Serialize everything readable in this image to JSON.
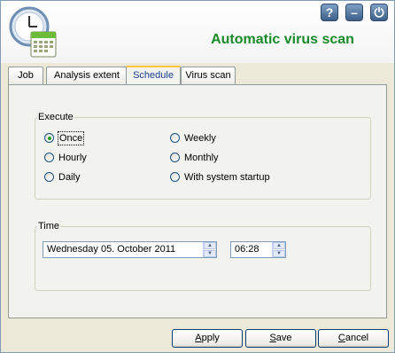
{
  "window": {
    "title": "Automatic virus scan"
  },
  "icons": {
    "app": "calendar-clock-icon",
    "help": "help-icon",
    "minimize": "minimize-icon",
    "close": "power-icon"
  },
  "window_buttons": {
    "help": "?",
    "minimize": "–",
    "close": "⏻"
  },
  "tabs": [
    {
      "label": "Job",
      "active": false
    },
    {
      "label": "Analysis extent",
      "active": false
    },
    {
      "label": "Schedule",
      "active": true
    },
    {
      "label": "Virus scan",
      "active": false
    }
  ],
  "execute": {
    "legend": "Execute",
    "options": [
      {
        "label": "Once",
        "checked": true
      },
      {
        "label": "Hourly",
        "checked": false
      },
      {
        "label": "Daily",
        "checked": false
      },
      {
        "label": "Weekly",
        "checked": false
      },
      {
        "label": "Monthly",
        "checked": false
      },
      {
        "label": "With system startup",
        "checked": false
      }
    ]
  },
  "time": {
    "legend": "Time",
    "date_value": "Wednesday 05.   October   2011",
    "time_value": "06:28"
  },
  "buttons": {
    "apply": {
      "label_first": "A",
      "label_rest": "pply"
    },
    "save": {
      "label_first": "S",
      "label_rest": "ave"
    },
    "cancel": {
      "label_first": "C",
      "label_rest": "ancel"
    }
  },
  "colors": {
    "title": "#1a8a2a",
    "radio_checked": "#21a121",
    "active_tab_top": "#ffc83c"
  }
}
